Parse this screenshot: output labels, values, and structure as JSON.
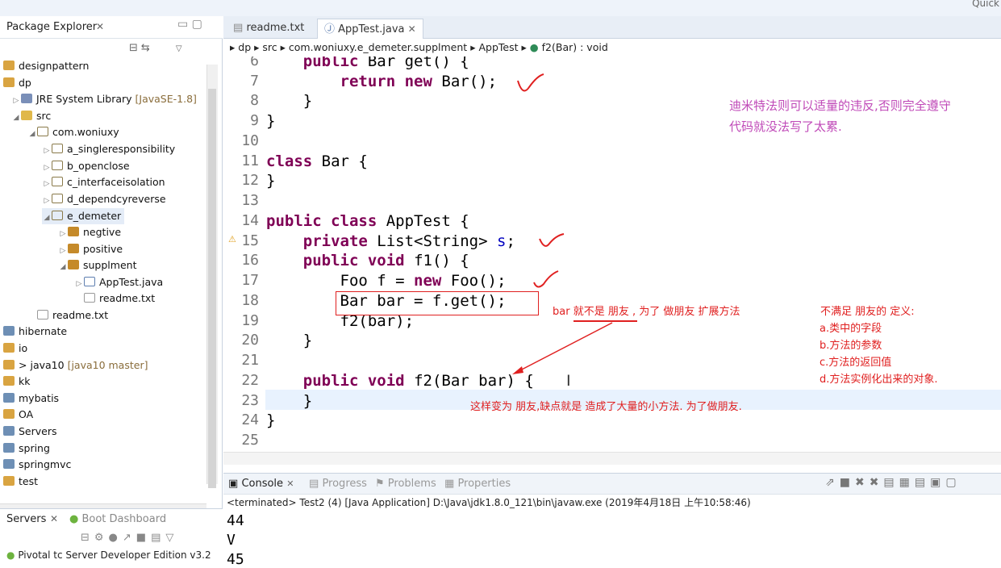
{
  "window": {
    "quick_access": "Quick"
  },
  "explorer": {
    "title": "Package Explorer",
    "items": [
      {
        "label": "designpattern",
        "decoration": ""
      },
      {
        "label": "dp",
        "decoration": ""
      },
      {
        "label": "JRE System Library",
        "decoration": "[JavaSE-1.8]"
      },
      {
        "label": "src",
        "decoration": ""
      },
      {
        "label": "com.woniuxy",
        "decoration": ""
      },
      {
        "label": "a_singleresponsibility",
        "decoration": ""
      },
      {
        "label": "b_openclose",
        "decoration": ""
      },
      {
        "label": "c_interfaceisolation",
        "decoration": ""
      },
      {
        "label": "d_dependcyreverse",
        "decoration": ""
      },
      {
        "label": "e_demeter",
        "decoration": ""
      },
      {
        "label": "negtive",
        "decoration": ""
      },
      {
        "label": "positive",
        "decoration": ""
      },
      {
        "label": "supplment",
        "decoration": ""
      },
      {
        "label": "AppTest.java",
        "decoration": ""
      },
      {
        "label": "readme.txt",
        "decoration": ""
      },
      {
        "label": "readme.txt",
        "decoration": ""
      },
      {
        "label": "hibernate",
        "decoration": ""
      },
      {
        "label": "io",
        "decoration": ""
      },
      {
        "label": "java10",
        "decoration": "[java10 master]",
        "prefix": ">"
      },
      {
        "label": "kk",
        "decoration": ""
      },
      {
        "label": "mybatis",
        "decoration": ""
      },
      {
        "label": "OA",
        "decoration": ""
      },
      {
        "label": "Servers",
        "decoration": ""
      },
      {
        "label": "spring",
        "decoration": ""
      },
      {
        "label": "springmvc",
        "decoration": ""
      },
      {
        "label": "test",
        "decoration": ""
      }
    ]
  },
  "servers_panel": {
    "title": "Servers",
    "boot_dashboard": "Boot Dashboard",
    "server_item": "Pivotal tc Server Developer Edition v3.2"
  },
  "editor": {
    "tabs": [
      {
        "label": "readme.txt"
      },
      {
        "label": "AppTest.java"
      }
    ],
    "breadcrumb": [
      "dp",
      "src",
      "com.woniuxy.e_demeter.supplment",
      "AppTest",
      "f2(Bar) : void"
    ],
    "line_numbers": [
      "6",
      "7",
      "8",
      "9",
      "10",
      "11",
      "12",
      "13",
      "14",
      "15",
      "16",
      "17",
      "18",
      "19",
      "20",
      "21",
      "22",
      "23",
      "24",
      "25"
    ],
    "lines": [
      "    public Bar get() {",
      "        return new Bar();",
      "    }",
      "}",
      "",
      "class Bar {",
      "}",
      "",
      "public class AppTest {",
      "    private List<String> s;",
      "    public void f1() {",
      "        Foo f = new Foo();",
      "        Bar bar = f.get();",
      "        f2(bar);",
      "    }",
      "",
      "    public void f2(Bar bar) {",
      "    }",
      "}",
      ""
    ]
  },
  "annotations": {
    "demeter_note": [
      "迪米特法则可以适量的违反,否则完全遵守",
      "代码就没法写了太累."
    ],
    "bar_note": "bar 就不是 朋友 , 为了 做朋友 扩展方法",
    "definition_title": "不满足 朋友的 定义:",
    "definition_items": [
      "a.类中的字段",
      "b.方法的参数",
      "c.方法的返回值",
      "d.方法实例化出来的对象."
    ],
    "bottom_note": "这样变为 朋友,缺点就是 造成了大量的小方法. 为了做朋友."
  },
  "console": {
    "tabs": [
      {
        "label": "Console"
      },
      {
        "label": "Progress"
      },
      {
        "label": "Problems"
      },
      {
        "label": "Properties"
      }
    ],
    "status": "<terminated> Test2 (4) [Java Application] D:\\Java\\jdk1.8.0_121\\bin\\javaw.exe (2019年4月18日 上午10:58:46)",
    "output": [
      "44",
      "V",
      "45"
    ]
  }
}
